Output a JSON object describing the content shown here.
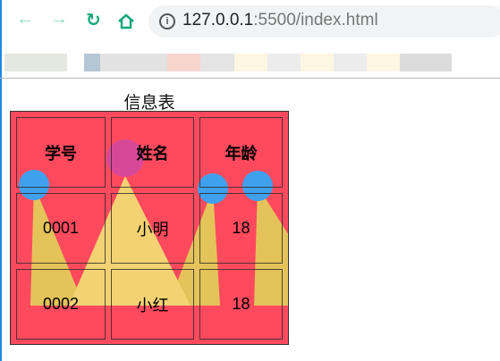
{
  "browser": {
    "url_host": "127.0.0.1",
    "url_rest": ":5500/index.html",
    "icons": [
      "back-icon",
      "forward-icon",
      "reload-icon",
      "home-icon",
      "info-icon"
    ]
  },
  "table": {
    "caption": "信息表",
    "headers": [
      "学号",
      "姓名",
      "年龄"
    ],
    "rows": [
      [
        "0001",
        "小明",
        "18"
      ],
      [
        "0002",
        "小红",
        "18"
      ]
    ]
  },
  "colors": {
    "table_bg": "#ff4a5e",
    "circle_blue": "#3fa0ee",
    "circle_pink": "#d84898",
    "beam": "#f2d272"
  }
}
